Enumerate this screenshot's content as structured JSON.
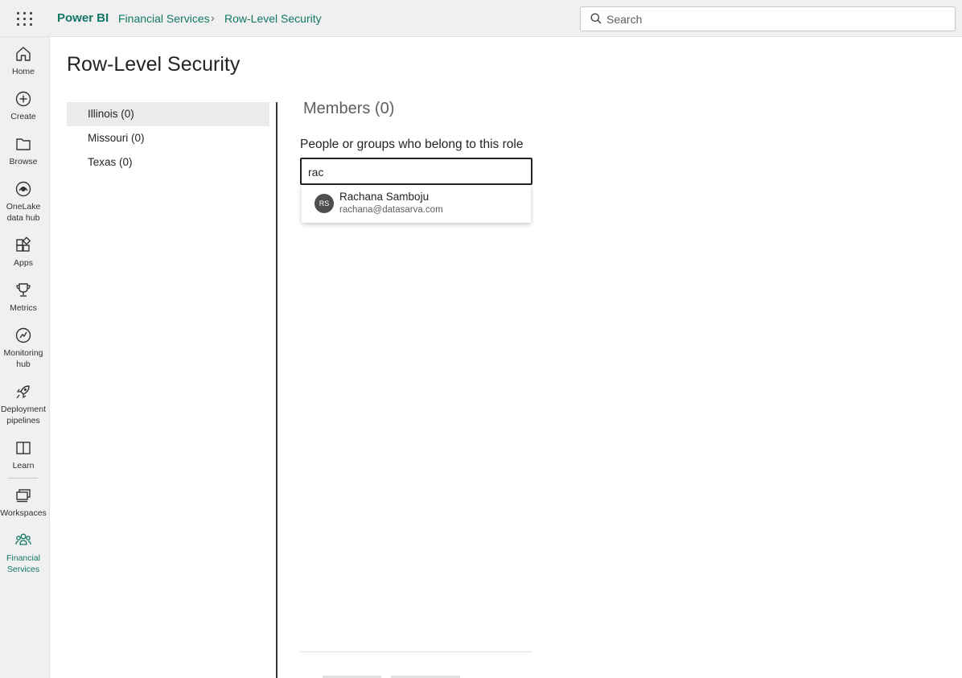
{
  "header": {
    "brand": "Power BI",
    "breadcrumb": [
      "Financial Services",
      "Row-Level Security"
    ],
    "breadcrumb_separator": "›",
    "search_placeholder": "Search"
  },
  "nav": {
    "items": [
      {
        "label": "Home",
        "icon": "home-icon"
      },
      {
        "label": "Create",
        "icon": "plus-circle-icon"
      },
      {
        "label": "Browse",
        "icon": "folder-icon"
      },
      {
        "label": "OneLake data hub",
        "icon": "onelake-icon"
      },
      {
        "label": "Apps",
        "icon": "apps-icon"
      },
      {
        "label": "Metrics",
        "icon": "trophy-icon"
      },
      {
        "label": "Monitoring hub",
        "icon": "monitor-icon"
      },
      {
        "label": "Deployment pipelines",
        "icon": "rocket-icon"
      },
      {
        "label": "Learn",
        "icon": "book-icon"
      },
      {
        "label": "Workspaces",
        "icon": "workspaces-icon"
      },
      {
        "label": "Financial Services",
        "icon": "people-icon",
        "active": true
      }
    ],
    "active_color": "#117865"
  },
  "page": {
    "title": "Row-Level Security"
  },
  "roles": [
    {
      "label": "Illinois (0)",
      "selected": true
    },
    {
      "label": "Missouri (0)",
      "selected": false
    },
    {
      "label": "Texas (0)",
      "selected": false
    }
  ],
  "members": {
    "title": "Members (0)",
    "field_label": "People or groups who belong to this role",
    "input_value": "rac",
    "suggestion": {
      "initials": "RS",
      "name": "Rachana Samboju",
      "email": "rachana@datasarva.com"
    }
  }
}
